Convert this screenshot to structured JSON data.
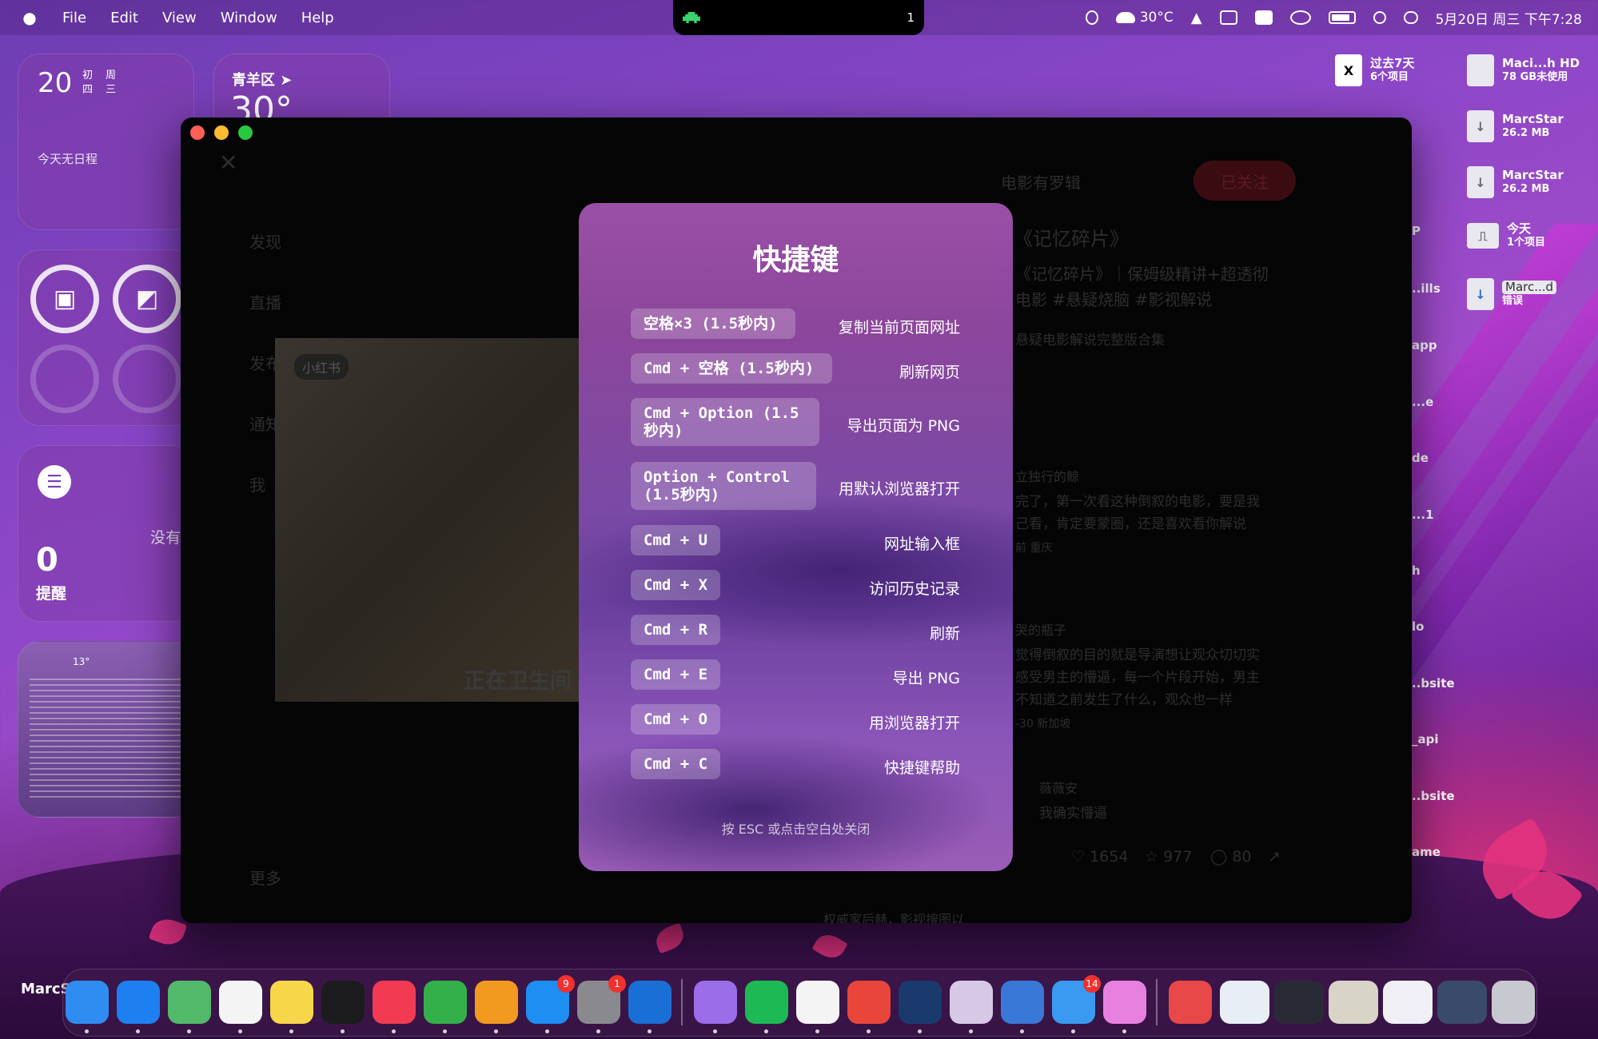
{
  "menubar": {
    "app_name": "MarcStar",
    "menus": [
      "File",
      "Edit",
      "View",
      "Window",
      "Help"
    ],
    "notch_count": "1",
    "temperature": "30°C",
    "datetime": "5月20日 周三  下午7:28"
  },
  "widgets": {
    "calendar": {
      "day": "20",
      "lunar_top": "初",
      "lunar_bottom": "四",
      "week_top": "周",
      "week_bottom": "三",
      "empty": "今天无日程"
    },
    "weather": {
      "location": "青羊区",
      "temp": "30°"
    },
    "reminders": {
      "count": "0",
      "label": "提醒",
      "none": "没有"
    },
    "terminal_preview": {
      "temp": "13°"
    }
  },
  "desktop_items": [
    {
      "name": "过去7天",
      "sub": "6个项目"
    },
    {
      "name": "Maci...h HD",
      "sub": "78 GB未使用"
    },
    {
      "name": "MarcStar",
      "sub": "26.2 MB"
    },
    {
      "name": "MarcStar",
      "sub": "26.2 MB"
    },
    {
      "name": "今天",
      "sub": "1个项目"
    },
    {
      "name": "Marc...d",
      "sub": "错误"
    }
  ],
  "desktop_truncated": [
    "P",
    "..ills",
    "app",
    "...e",
    "de",
    "...1",
    "h",
    "lo",
    "..bsite",
    "_api",
    "..bsite",
    "ame"
  ],
  "background_page": {
    "author": "电影有罗辑",
    "follow": "已关注",
    "title": "《记忆碎片》",
    "desc_line1": "《记忆碎片》｜保姆级精讲+超透彻",
    "desc_line2": "电影 #悬疑烧脑 #影视解说",
    "search": "悬疑电影解说完整版合集",
    "video_caption": "正在卫生间",
    "video_tag": "小红书",
    "comment1_user": "立独行的鲸",
    "comment1_line1": "完了，第一次看这种倒叙的电影，要是我",
    "comment1_line2": "己看，肯定要蒙圈，还是喜欢看你解说",
    "comment1_meta": "前 重庆",
    "comment2_user": "哭的瓶子",
    "comment2_line1": "觉得倒叙的目的就是导演想让观众切切实",
    "comment2_line2": "感受男主的懵逼，每一个片段开始，男主",
    "comment2_line3": "不知道之前发生了什么，观众也一样",
    "comment2_meta": "-30 新加坡",
    "comment3_user": "薇薇安",
    "comment3_text": "我确实懵逼",
    "likes": "1654",
    "stars": "977",
    "comments": "80",
    "side_nav": [
      "发现",
      "直播",
      "发布",
      "通知",
      "我",
      "更多"
    ],
    "bottom_text": "权威家后赫，影视搜图以"
  },
  "shortcuts_modal": {
    "title": "快捷键",
    "items": [
      {
        "key": "空格×3 (1.5秒内)",
        "desc": "复制当前页面网址"
      },
      {
        "key": "Cmd + 空格 (1.5秒内)",
        "desc": "刷新网页"
      },
      {
        "key": "Cmd + Option (1.5 秒内)",
        "desc": "导出页面为 PNG"
      },
      {
        "key": "Option + Control (1.5秒内)",
        "desc": "用默认浏览器打开"
      },
      {
        "key": "Cmd + U",
        "desc": "网址输入框"
      },
      {
        "key": "Cmd + X",
        "desc": "访问历史记录"
      },
      {
        "key": "Cmd + R",
        "desc": "刷新"
      },
      {
        "key": "Cmd + E",
        "desc": "导出 PNG"
      },
      {
        "key": "Cmd + O",
        "desc": "用浏览器打开"
      },
      {
        "key": "Cmd + C",
        "desc": "快捷键帮助"
      }
    ],
    "footer": "按 ESC 或点击空白处关闭"
  },
  "dock": {
    "apps": [
      {
        "name": "finder",
        "color": "#2f8cf0"
      },
      {
        "name": "safari",
        "color": "#1d7ff0"
      },
      {
        "name": "maps",
        "color": "#52b86a"
      },
      {
        "name": "reminders",
        "color": "#f4f4f4"
      },
      {
        "name": "notes",
        "color": "#f7d64a"
      },
      {
        "name": "tv",
        "color": "#1c1c1e"
      },
      {
        "name": "music",
        "color": "#f23a52"
      },
      {
        "name": "numbers",
        "color": "#34b04a"
      },
      {
        "name": "pages",
        "color": "#f29a1f"
      },
      {
        "name": "app-store",
        "color": "#1e8ef2",
        "badge": "9"
      },
      {
        "name": "system-settings",
        "color": "#8a8a8e",
        "badge": "1"
      },
      {
        "name": "xcode",
        "color": "#1a6fd6"
      },
      {
        "name": "cat-app",
        "color": "#9b6de8"
      },
      {
        "name": "spotify",
        "color": "#1db954"
      },
      {
        "name": "calendar-grid",
        "color": "#f4f4f4"
      },
      {
        "name": "chrome",
        "color": "#e8463a"
      },
      {
        "name": "ai-app",
        "color": "#1a3a6e"
      },
      {
        "name": "terminal-app",
        "color": "#d8c8e8"
      },
      {
        "name": "disk-app",
        "color": "#3a78d8"
      },
      {
        "name": "mail",
        "color": "#3a9af2",
        "badge": "14"
      },
      {
        "name": "flow-app",
        "color": "#e880e0"
      }
    ]
  },
  "colors": {
    "accent_red": "#ff5f57",
    "accent_yellow": "#febc2e",
    "accent_green": "#28c840",
    "badge": "#f0312f"
  }
}
